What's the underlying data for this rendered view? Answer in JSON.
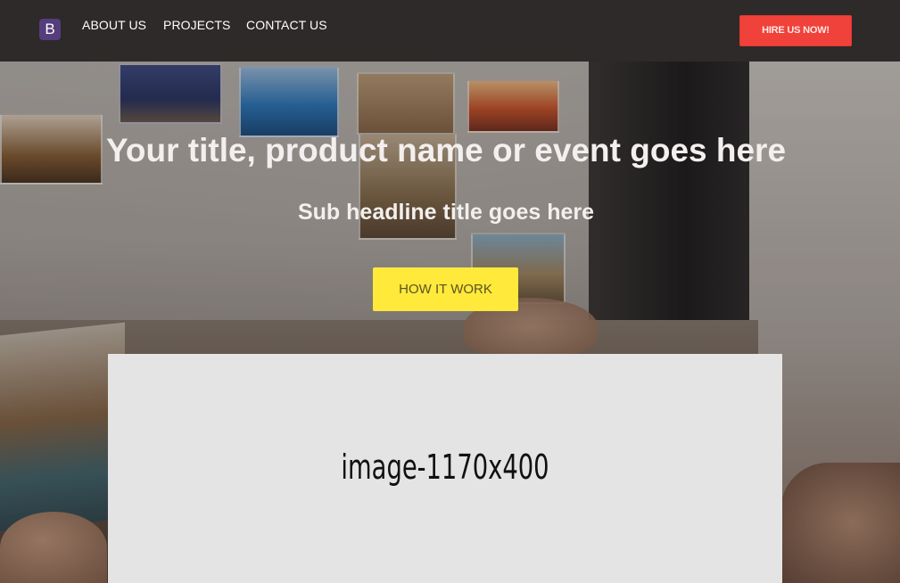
{
  "navbar": {
    "brand_letter": "B",
    "links": [
      "ABOUT US",
      "PROJECTS",
      "CONTACT US"
    ],
    "cta_label": "HIRE US NOW!"
  },
  "hero": {
    "title": "Your title, product name or event goes here",
    "subtitle": "Sub headline title goes here",
    "button_label": "HOW IT WORK"
  },
  "placeholder": {
    "label": "image-1170x400"
  },
  "colors": {
    "navbar_bg": "#2d2a29",
    "brand_bg": "#563d7c",
    "cta_bg": "#f0413a",
    "hero_button_bg": "#ffe93a",
    "placeholder_bg": "#e4e4e4"
  }
}
